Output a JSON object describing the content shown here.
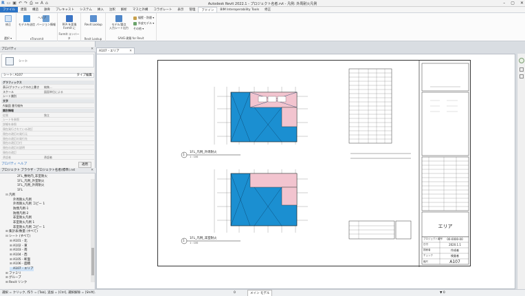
{
  "app": {
    "title": "Autodesk Revit 2022.1 - プロジェクト名者.rvt - 凡例: 外周耐火凡例"
  },
  "tabs": [
    "ファイル",
    "建築",
    "構造",
    "鉄骨",
    "プレキャスト",
    "システム",
    "挿入",
    "注釈",
    "解析",
    "マスと外構",
    "コラボレート",
    "表示",
    "管理",
    "アドイン",
    "BIM Interoperability Tools",
    "修正"
  ],
  "active_tab": "アドイン",
  "ribbon": {
    "modify_label": "修正",
    "select_label": "選択 ▾",
    "etransmit_btn": "モデルを送信",
    "version_btn": "バージョン情報",
    "help_btn": "ヘルプ",
    "etransmit_group": "eTransmit",
    "formit_btn": "RFA を変換\nFormit に",
    "formit_group": "FormIt コンバータ",
    "lookup_btn": "Revit Lookup",
    "lookup_group": "Revit Lookup",
    "save_btn": "モデル/要点\n入力シート出力",
    "settings_btn": "幅壁・防煙 ▾",
    "material_btn": "外皮モデル ▾",
    "other_btn": "その他 ▾",
    "save_group": "SAVE-建築 for Revit"
  },
  "properties": {
    "title": "プロパティ",
    "type_name": "シート",
    "selector": "シート: A107",
    "edit_type": "タイプ編集",
    "rows": [
      {
        "k": "グラフィックス",
        "v": "",
        "cat": true
      },
      {
        "k": "表示/グラフィックスの上書き",
        "v": "編集...",
        "cat": false
      },
      {
        "k": "スケール",
        "v": "図面単位による",
        "cat": false
      },
      {
        "k": "シート識別",
        "v": "",
        "cat": false
      },
      {
        "k": "文字",
        "v": "",
        "cat": true
      },
      {
        "k": "AI楽園 番号維持",
        "v": "",
        "cat": false
      },
      {
        "k": "識別情報",
        "v": "",
        "cat": true
      },
      {
        "k": "従属",
        "v": "独立",
        "cat": false,
        "gray": true
      },
      {
        "k": "シートを参照",
        "v": "",
        "cat": false,
        "gray": true
      },
      {
        "k": "詳細を参照",
        "v": "",
        "cat": false,
        "gray": true
      },
      {
        "k": "現在発行されている改訂",
        "v": "",
        "cat": false,
        "gray": true
      },
      {
        "k": "現在の改訂の発行元",
        "v": "",
        "cat": false,
        "gray": true
      },
      {
        "k": "現在の改訂の発行先",
        "v": "",
        "cat": false,
        "gray": true
      },
      {
        "k": "現在の改訂日付",
        "v": "",
        "cat": false,
        "gray": true
      },
      {
        "k": "現在の改訂の説明",
        "v": "",
        "cat": false,
        "gray": true
      },
      {
        "k": "現在の改訂",
        "v": "",
        "cat": false,
        "gray": true
      },
      {
        "k": "承認者",
        "v": "承認者",
        "cat": false,
        "gray": true
      }
    ],
    "help_link": "プロパティ ヘルプ",
    "apply": "適用"
  },
  "browser": {
    "title": "プロジェクト ブラウザ - プロジェクト名者(標準).rvt",
    "items": [
      {
        "label": "2FL_敷地内_非室耐火",
        "indent": 3,
        "tog": "",
        "sel": false
      },
      {
        "label": "1FL_凡例_外室耐火",
        "indent": 3,
        "tog": "",
        "sel": false
      },
      {
        "label": "1FL_凡例_外周耐火",
        "indent": 3,
        "tog": "",
        "sel": false
      },
      {
        "label": "1FL",
        "indent": 3,
        "tog": "",
        "sel": false
      },
      {
        "label": "凡例",
        "indent": 1,
        "tog": "⊟",
        "sel": false
      },
      {
        "label": "外周耐火凡例",
        "indent": 2,
        "tog": "",
        "sel": false
      },
      {
        "label": "外周耐火凡例 コピー 1",
        "indent": 2,
        "tog": "",
        "sel": false
      },
      {
        "label": "防煙凡例-1",
        "indent": 2,
        "tog": "",
        "sel": false
      },
      {
        "label": "防煙凡例-2",
        "indent": 2,
        "tog": "",
        "sel": false
      },
      {
        "label": "非室耐火凡例",
        "indent": 2,
        "tog": "",
        "sel": false
      },
      {
        "label": "非室耐火凡例 1",
        "indent": 2,
        "tog": "",
        "sel": false
      },
      {
        "label": "非室耐火凡例 コピー 1",
        "indent": 2,
        "tog": "",
        "sel": false
      },
      {
        "label": "集計表/数量 (すべて)",
        "indent": 1,
        "tog": "⊞",
        "sel": false
      },
      {
        "label": "シート (すべて)",
        "indent": 1,
        "tog": "⊟",
        "sel": false
      },
      {
        "label": "A101 - 北",
        "indent": 2,
        "tog": "⊞",
        "sel": false
      },
      {
        "label": "A102 - 東",
        "indent": 2,
        "tog": "⊞",
        "sel": false
      },
      {
        "label": "A103 - 南",
        "indent": 2,
        "tog": "⊞",
        "sel": false
      },
      {
        "label": "A104 - 西",
        "indent": 2,
        "tog": "⊞",
        "sel": false
      },
      {
        "label": "A105 - 断面",
        "indent": 2,
        "tog": "⊞",
        "sel": false
      },
      {
        "label": "A106 - 面積",
        "indent": 2,
        "tog": "⊞",
        "sel": false
      },
      {
        "label": "A107 - エリア",
        "indent": 2,
        "tog": "",
        "sel": true
      },
      {
        "label": "ファミリ",
        "indent": 1,
        "tog": "⊞",
        "sel": false
      },
      {
        "label": "グループ",
        "indent": 1,
        "tog": "⊞",
        "sel": false
      },
      {
        "label": "Revit リンク",
        "indent": 1,
        "tog": "⊞",
        "sel": false
      }
    ]
  },
  "view_tab": "A107 - エリア",
  "drawing": {
    "plan1_label": "1FL_凡例_外周耐火",
    "plan2_label": "1FL_凡例_非室耐火",
    "plan_num1": "1",
    "plan_num2": "1",
    "title_block_name": "エリア",
    "sheet_number": "A107",
    "tb_rows": [
      {
        "k": "プロジェクト番号",
        "v": "00-0000-00"
      },
      {
        "k": "日付",
        "v": "2020.1.1"
      },
      {
        "k": "図面者",
        "v": "作成者"
      },
      {
        "k": "チェック",
        "v": "検査者"
      }
    ],
    "scale": "縮尺",
    "scale_value": "1 : 100"
  },
  "status": {
    "left": "選択 = クリック, 作り = [Tab], 追加 = [Ctrl], 選択解除 = [Shift].",
    "model": "メイン モデル",
    "zero": "0"
  },
  "colors": {
    "accent": "#2a73c6",
    "fill_blue": "#1b8fd1",
    "fill_pink": "#f2c4cf"
  }
}
